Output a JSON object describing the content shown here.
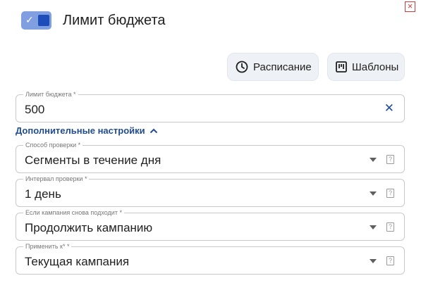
{
  "dialog": {
    "close_glyph": "×",
    "title": "Лимит бюджета",
    "toggle": {
      "checked": true,
      "check_glyph": "✓"
    }
  },
  "toolbar": {
    "schedule_label": "Расписание",
    "schedule_icon": "clock-icon",
    "templates_label": "Шаблоны",
    "templates_icon": "template-icon"
  },
  "budget": {
    "label": "Лимит бюджета *",
    "value": "500",
    "clear_glyph": "✕"
  },
  "advanced": {
    "label": "Дополнительные настройки",
    "expanded": true
  },
  "fields": [
    {
      "label": "Способ проверки *",
      "value": "Сегменты в течение дня",
      "help_glyph": "?"
    },
    {
      "label": "Интервал проверки *",
      "value": "1 день",
      "help_glyph": "?"
    },
    {
      "label": "Если кампания снова подходит *",
      "value": "Продолжить кампанию",
      "help_glyph": "?"
    },
    {
      "label": "Применить к* *",
      "value": "Текущая кампания",
      "help_glyph": "?"
    }
  ],
  "colors": {
    "toggle_track": "#7f9fe0",
    "toggle_knob": "#1c4db8",
    "link": "#214c8f",
    "close": "#d23b3b",
    "button_bg": "#eef2f6"
  }
}
